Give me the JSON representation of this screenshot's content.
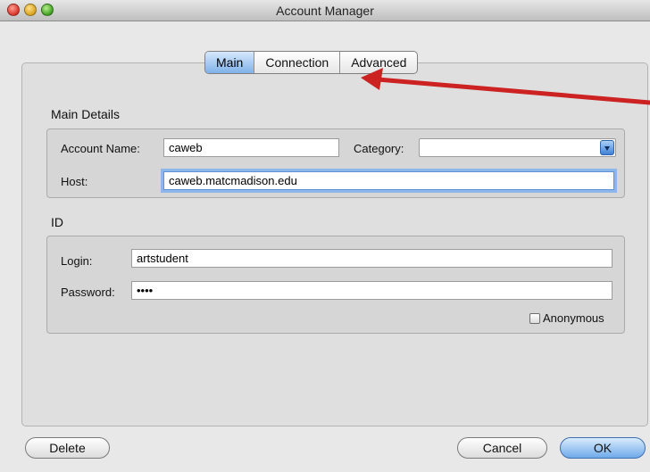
{
  "window": {
    "title": "Account Manager"
  },
  "tabs": [
    {
      "label": "Main",
      "active": true
    },
    {
      "label": "Connection",
      "active": false
    },
    {
      "label": "Advanced",
      "active": false
    }
  ],
  "main_details": {
    "section_title": "Main Details",
    "account_name_label": "Account Name:",
    "account_name_value": "caweb",
    "category_label": "Category:",
    "category_value": "",
    "host_label": "Host:",
    "host_value": "caweb.matcmadison.edu"
  },
  "id_section": {
    "section_title": "ID",
    "login_label": "Login:",
    "login_value": "artstudent",
    "password_label": "Password:",
    "password_value": "••••",
    "anonymous_label": "Anonymous",
    "anonymous_checked": false
  },
  "footer": {
    "delete_label": "Delete",
    "cancel_label": "Cancel",
    "ok_label": "OK"
  },
  "colors": {
    "annotation_arrow": "#cc2222",
    "focus_ring": "#8db7ea",
    "primary_button": "#6fa9ea"
  },
  "icons": {
    "annotation": "arrow-annotation-icon",
    "category_dropdown": "chevron-down-icon"
  }
}
